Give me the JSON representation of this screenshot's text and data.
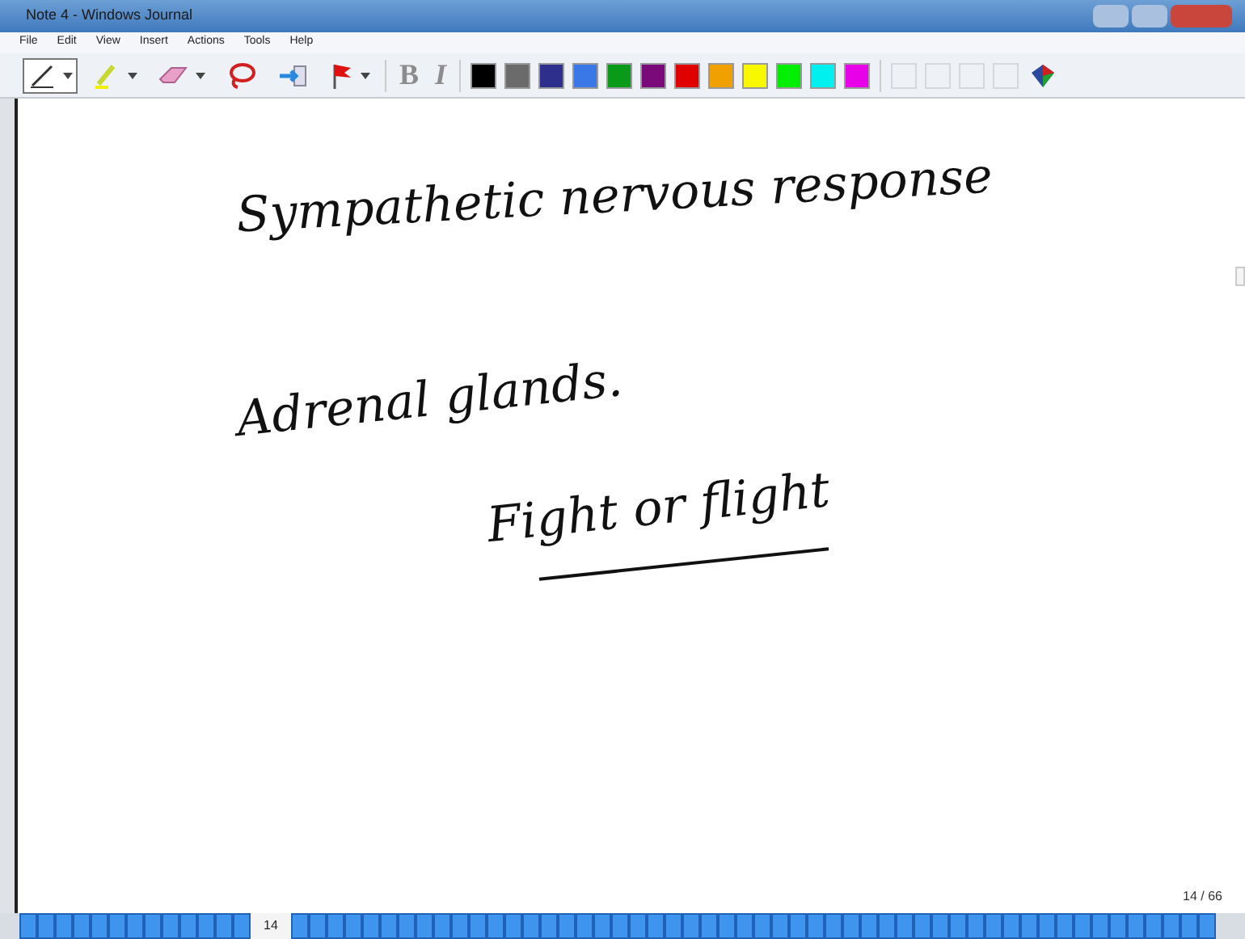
{
  "window": {
    "title": "Note 4 - Windows Journal"
  },
  "menu": [
    "File",
    "Edit",
    "View",
    "Insert",
    "Actions",
    "Tools",
    "Help"
  ],
  "tools": [
    {
      "kind": "pen",
      "selected": true,
      "dropdown": true
    },
    {
      "kind": "highlighter",
      "selected": false,
      "dropdown": true
    },
    {
      "kind": "eraser",
      "selected": false,
      "dropdown": true
    },
    {
      "kind": "lasso",
      "selected": false,
      "dropdown": false
    },
    {
      "kind": "insert-space",
      "selected": false,
      "dropdown": false
    },
    {
      "kind": "flag",
      "selected": false,
      "dropdown": true
    }
  ],
  "format": [
    {
      "label": "B",
      "disabled": true
    },
    {
      "label": "I",
      "disabled": true
    }
  ],
  "colors": [
    {
      "color": "#000000"
    },
    {
      "color": "#6b6b6b"
    },
    {
      "color": "#2e2e8c"
    },
    {
      "color": "#3a78e8"
    },
    {
      "color": "#0a9a1a"
    },
    {
      "color": "#7a0a7a"
    },
    {
      "color": "#e00000"
    },
    {
      "color": "#f0a000"
    },
    {
      "color": "#f8f800"
    },
    {
      "color": "#00ee00"
    },
    {
      "color": "#00f0f0"
    },
    {
      "color": "#e800e8"
    }
  ],
  "custom_colors": [
    {
      "empty": true
    },
    {
      "empty": true
    },
    {
      "empty": true
    },
    {
      "empty": true
    }
  ],
  "note": [
    {
      "kind": "text",
      "text": "Sympathetic nervous response"
    },
    {
      "kind": "text",
      "text": "Adrenal glands."
    },
    {
      "kind": "text",
      "text": "Fight or flight"
    },
    {
      "kind": "underline"
    }
  ],
  "page_counter": "14 / 66",
  "pages": [
    {
      "selected": false
    },
    {
      "selected": false
    },
    {
      "selected": false
    },
    {
      "selected": false
    },
    {
      "selected": false
    },
    {
      "selected": false
    },
    {
      "selected": false
    },
    {
      "selected": false
    },
    {
      "selected": false
    },
    {
      "selected": false
    },
    {
      "selected": false
    },
    {
      "selected": false
    },
    {
      "selected": false
    },
    {
      "label": "14",
      "selected": true
    },
    {
      "selected": false
    },
    {
      "selected": false
    },
    {
      "selected": false
    },
    {
      "selected": false
    },
    {
      "selected": false
    },
    {
      "selected": false
    },
    {
      "selected": false
    },
    {
      "selected": false
    },
    {
      "selected": false
    },
    {
      "selected": false
    },
    {
      "selected": false
    },
    {
      "selected": false
    },
    {
      "selected": false
    },
    {
      "selected": false
    },
    {
      "selected": false
    },
    {
      "selected": false
    },
    {
      "selected": false
    },
    {
      "selected": false
    },
    {
      "selected": false
    },
    {
      "selected": false
    },
    {
      "selected": false
    },
    {
      "selected": false
    },
    {
      "selected": false
    },
    {
      "selected": false
    },
    {
      "selected": false
    },
    {
      "selected": false
    },
    {
      "selected": false
    },
    {
      "selected": false
    },
    {
      "selected": false
    },
    {
      "selected": false
    },
    {
      "selected": false
    },
    {
      "selected": false
    },
    {
      "selected": false
    },
    {
      "selected": false
    },
    {
      "selected": false
    },
    {
      "selected": false
    },
    {
      "selected": false
    },
    {
      "selected": false
    },
    {
      "selected": false
    },
    {
      "selected": false
    },
    {
      "selected": false
    },
    {
      "selected": false
    },
    {
      "selected": false
    },
    {
      "selected": false
    },
    {
      "selected": false
    },
    {
      "selected": false
    },
    {
      "selected": false
    },
    {
      "selected": false
    },
    {
      "selected": false
    },
    {
      "selected": false
    },
    {
      "selected": false
    },
    {
      "selected": false
    }
  ]
}
